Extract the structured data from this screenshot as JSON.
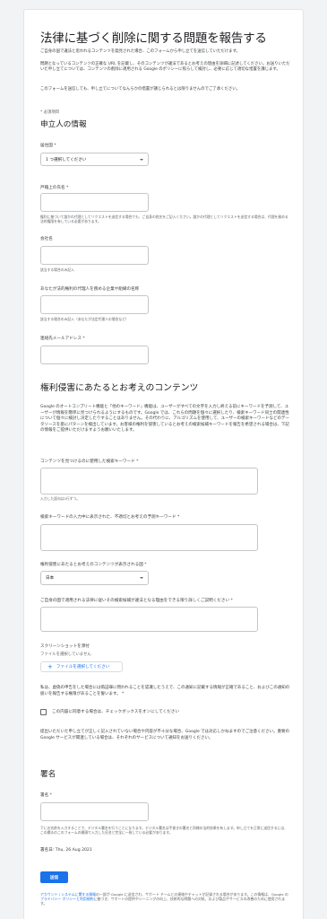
{
  "header": {
    "title": "法律に基づく削除に関する問題を報告する",
    "intro_1": "ご自身の国で違法と思われるコンテンツを発見された場合、このフォームから申し立てを送信していただけます。",
    "intro_2": "問題となっているコンテンツの正確な URL を記載し、そのコンテンツが違法であるとお考えの理由を詳細に記述してください。お送りいただいた申し立てについては、コンテンツの削除に適用される Google のポリシーに照らして検討し、必要に応じて適切な措置を講じます。",
    "intro_3": "このフォームを送信しても、申し立てについてなんらかの措置が講じられるとは限りませんのでご了承ください。",
    "required_note": "* 必須項目"
  },
  "requester": {
    "heading": "申立人の情報",
    "country_label": "居住国 *",
    "country_value": "1 つ選択してください",
    "name_label": "戸籍上の氏名 *",
    "name_hint": "権利に基づいて誰かの代理としてリクエストを送信する場合でも、ご自身の姓名をご記入ください。誰かの代理としてリクエストを送信する場合は、代理を務める法的権限を有している必要があります。",
    "company_label": "会社名",
    "company_hint": "該当する場合のみ記入",
    "client_label": "あなたが法的権利の代理人を務める企業や組織の名称",
    "client_hint": "該当する場合のみ記入（あなたが法定代理人の場合など）",
    "email_label": "連絡先メールアドレス *"
  },
  "content": {
    "heading": "権利侵害にあたるとお考えのコンテンツ",
    "description": "Google のオートコンプリート機能と「他のキーワード」機能は、ユーザーがすべての文字を入力し終える前にキーワードを予測して、ユーザーが情報を簡単に見つけられるようにするものです。Google では、これらの問題を個々に選択したり、検索キーワード同士の関連性について個々に検討し決定したりすることはありません。その代わりに、アルゴリズムを使用して、ユーザーの検索キーワードなどのデータソースを基にパターンを検出しています。お客様の権利を侵害しているとお考えの検索候補キーワードを報告を希望される場合は、下記の情報をご提供いただけますようお願いいたします。",
    "query_label": "コンテンツを見つけるのに使用した検索キーワード *",
    "query_hint": "入力した語句は1行ずつ。",
    "prediction_label": "検索キーワードの入力中に表示された、不適切とお考えの予測キーワード *",
    "country_shown_label": "権利侵害にあたるとお考えのコンテンツが表示される国 *",
    "country_shown_value": "日本",
    "explain_label": "ご自身の国で適用される法律に従いその検索候補が違法となる理由をできる限り詳しくご説明ください *",
    "screenshot_label": "スクリーンショットを添付",
    "screenshot_status": "ファイルを選択していません",
    "file_button": "ファイルを選択してください",
    "attest_text": "私は、虚偽の申告をした場合には偽証罪に問われることを認識したうえで、この通知に記載する情報が正確であること、およびこの通知の扱いを報告する権限があることを誓います。 *",
    "checkbox_label": "この内容に同意する場合は、チェックボックスをオンにしてください",
    "notice": "提出いただいた申し立てが正しく記入されていない場合や内容が不十分な場合、Google では対応しかねますのでご注意ください。重要の Google サービスが関連している場合は、それぞれのサービスについて通知をお送りください。"
  },
  "signature": {
    "heading": "署名",
    "label": "署名 *",
    "hint": "下にお名前を入力することで、デジタル署名を行うことになります。デジタル署名は手書きの署名と同様の法的効果を有します。申し立てを正常に送信するには、この欄るのこのフォームの開頭で入力した氏名と完全に一致している必要があります。",
    "date": "署名日: Thu, 26 Aug 2021"
  },
  "submit_label": "送信",
  "footer": {
    "text_1": "アカウント / システムに関する情報",
    "text_2": "の一部が Google に送信され、サポート チームとの連絡やチャットが記録される場合があります。この情報は、Google の",
    "privacy_link": "プライバシー ポリシーと利用規約",
    "text_3": "に基づき、サポートの提供やシーニングの向上、技術的な問題への対処、および製品やサービスの改善のために使用されます。"
  },
  "colors": {
    "accent": "#1a73e8",
    "background": "#f1f3f4",
    "card": "#ffffff"
  }
}
